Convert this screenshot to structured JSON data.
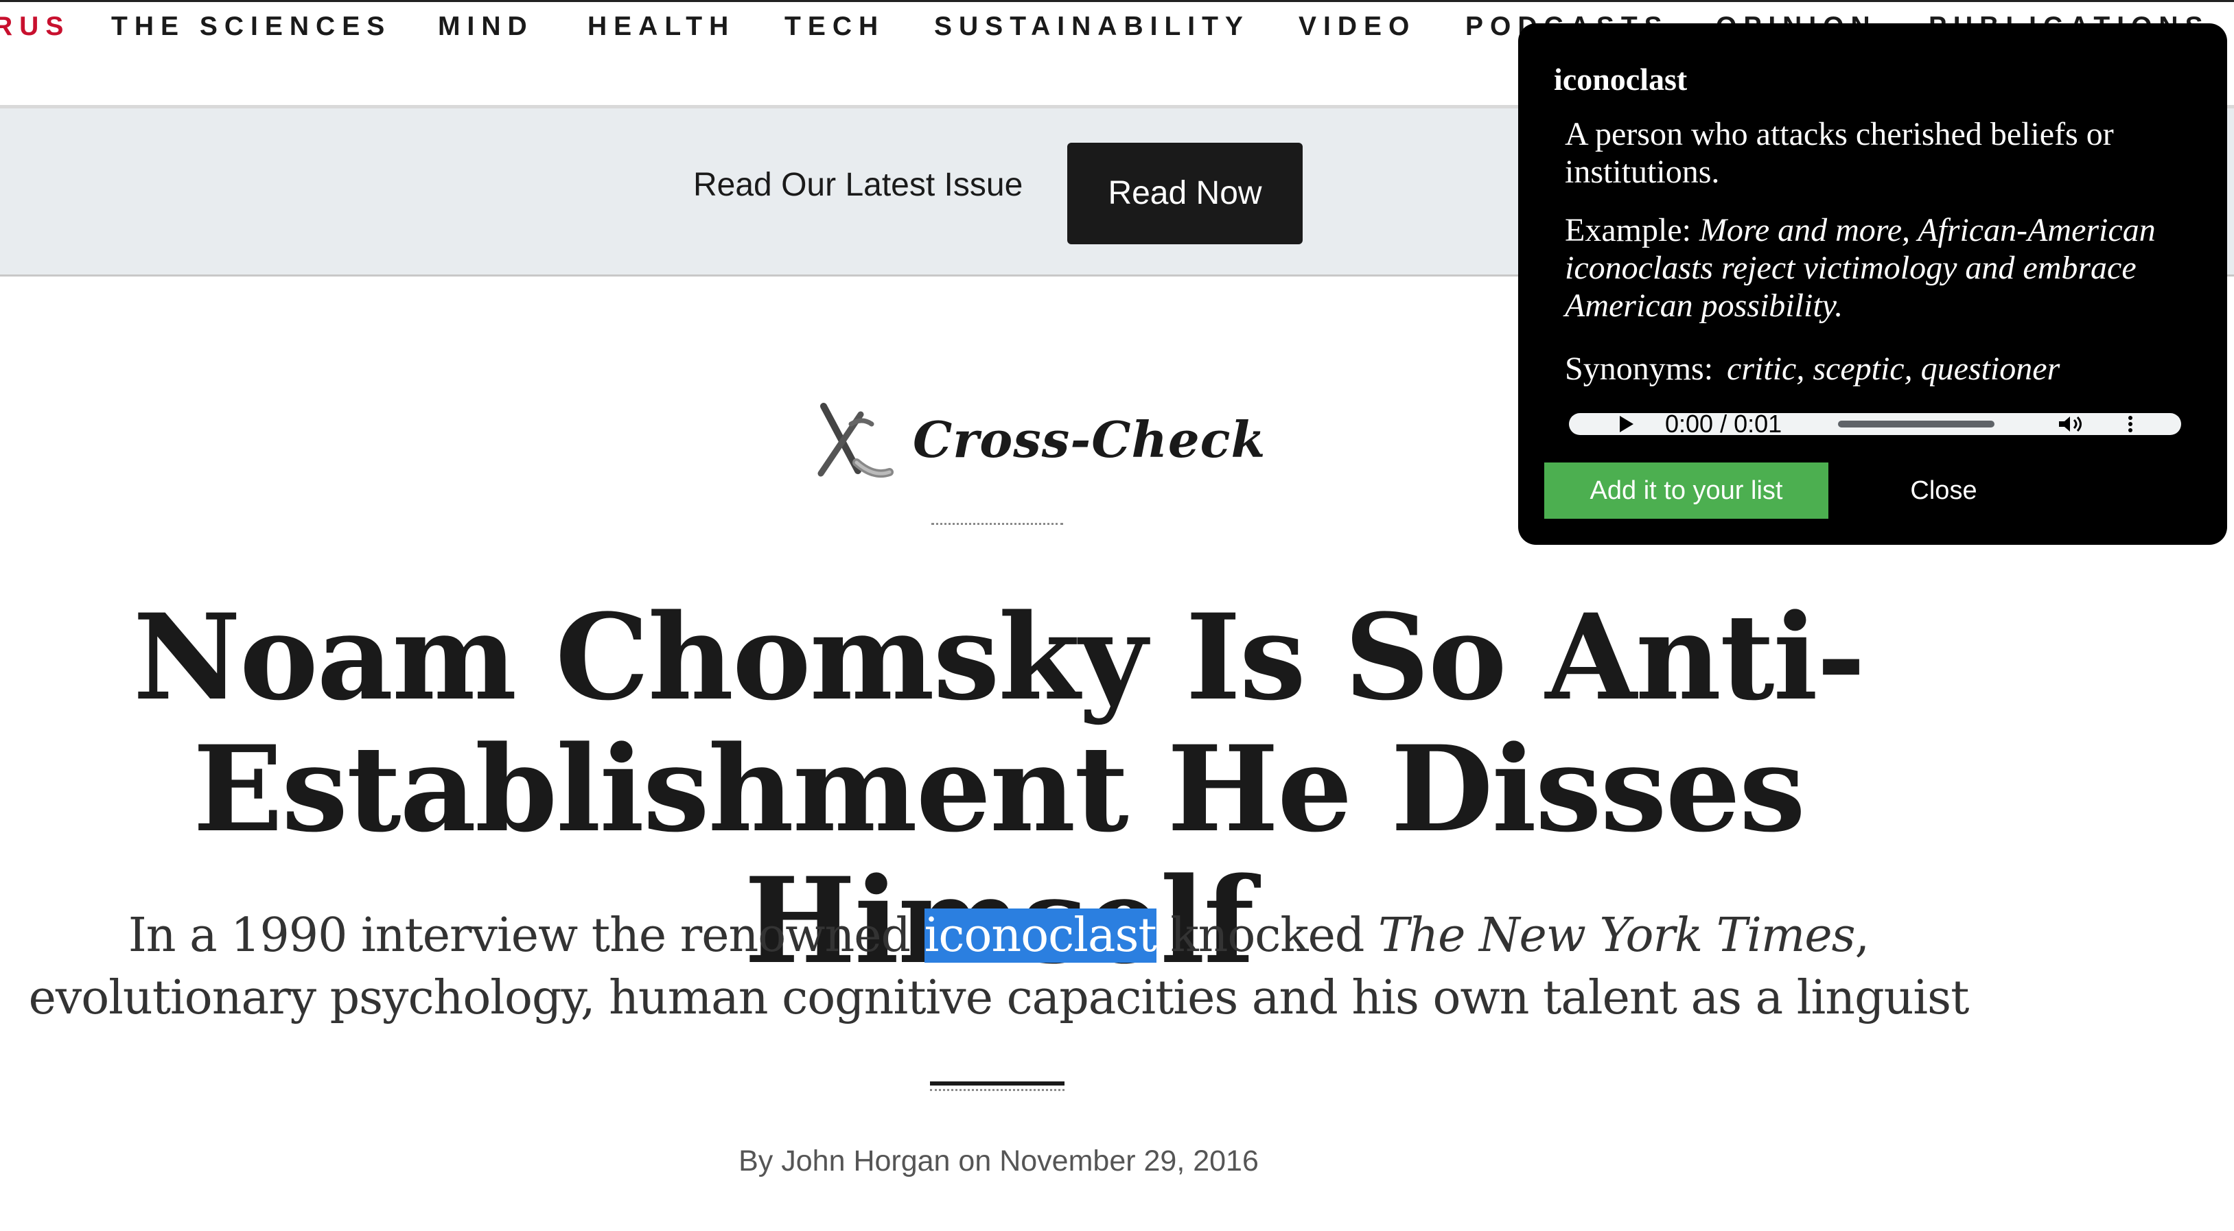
{
  "nav": {
    "items": [
      {
        "label": "RUS"
      },
      {
        "label": "THE SCIENCES"
      },
      {
        "label": "MIND"
      },
      {
        "label": "HEALTH"
      },
      {
        "label": "TECH"
      },
      {
        "label": "SUSTAINABILITY"
      },
      {
        "label": "VIDEO"
      },
      {
        "label": "PODCASTS"
      },
      {
        "label": "OPINION"
      },
      {
        "label": "PUBLICATIONS"
      }
    ],
    "accent_color": "#c8102e"
  },
  "issue_bar": {
    "text": "Read Our Latest Issue",
    "button_label": "Read Now"
  },
  "column": {
    "name": "Cross-Check",
    "icon": "pickaxe-icon"
  },
  "article": {
    "headline": "Noam Chomsky Is So Anti-Establishment He Disses Himself",
    "dek": {
      "before_highlight": "In a 1990 interview the renowned ",
      "highlight": "iconoclast",
      "after_highlight": " knocked ",
      "publication": "The New York Times",
      "rest": ", evolutionary psychology, human cognitive capacities and his own talent as a linguist"
    },
    "byline": "By John Horgan on November 29, 2016"
  },
  "popup": {
    "word": "iconoclast",
    "definition": "A person who attacks cherished beliefs or institutions.",
    "example_label": "Example:",
    "example_text": "More and more, African-American iconoclasts reject victimology and embrace American possibility.",
    "synonyms_label": "Synonyms:",
    "synonyms_text": "critic, sceptic, questioner",
    "audio_time": "0:00 / 0:01",
    "add_label": "Add it to your list",
    "close_label": "Close",
    "add_color": "#4caf50"
  },
  "colors": {
    "highlight": "#2b7fe0",
    "banner_bg": "#e8ecef"
  }
}
